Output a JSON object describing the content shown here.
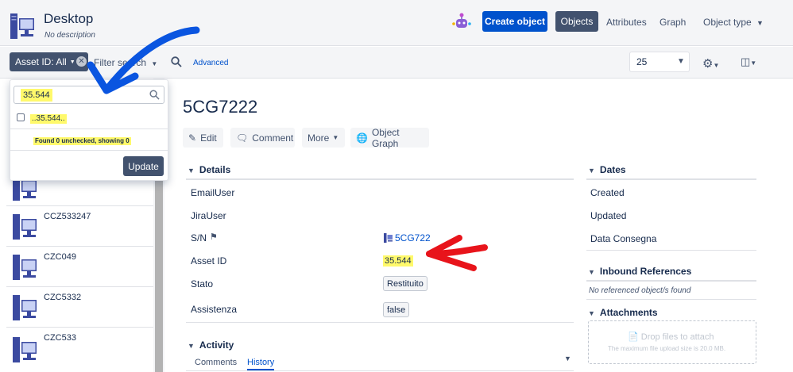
{
  "header": {
    "title": "Desktop",
    "subtitle": "No description",
    "create_label": "Create object",
    "objects_label": "Objects",
    "attributes_label": "Attributes",
    "graph_label": "Graph",
    "object_type_label": "Object type"
  },
  "toolbar": {
    "filter_chip_label": "Asset ID: All",
    "filter_search_label": "Filter search",
    "advanced_label": "Advanced",
    "per_page_value": "25"
  },
  "popup": {
    "search_value": "35.544",
    "option_label": "..35.544..",
    "found_text": "Found 0 unchecked, showing 0",
    "update_label": "Update"
  },
  "list": {
    "items": [
      {
        "label": ""
      },
      {
        "label": "CCZ533247"
      },
      {
        "label": "CZC049"
      },
      {
        "label": "CZC5332"
      },
      {
        "label": "CZC533"
      }
    ]
  },
  "object": {
    "title": "5CG7222",
    "actions": {
      "edit": "Edit",
      "comment": "Comment",
      "more": "More",
      "graph": "Object Graph"
    }
  },
  "details": {
    "heading": "Details",
    "fields": [
      {
        "label": "EmailUser",
        "value": ""
      },
      {
        "label": "JiraUser",
        "value": ""
      },
      {
        "label": "S/N",
        "value": "5CG722"
      },
      {
        "label": "Asset ID",
        "value": "35.544"
      },
      {
        "label": "Stato",
        "value": "Restituito"
      },
      {
        "label": "Assistenza",
        "value": "false"
      }
    ]
  },
  "dates": {
    "heading": "Dates",
    "items": [
      "Created",
      "Updated",
      "Data Consegna"
    ]
  },
  "inbound": {
    "heading": "Inbound References",
    "empty_text": "No referenced object/s found"
  },
  "attachments": {
    "heading": "Attachments",
    "drop_title": "Drop files to attach",
    "drop_sub": "The maximum file upload size is 20.0 MB."
  },
  "activity": {
    "heading": "Activity",
    "tabs": [
      "Comments",
      "History"
    ]
  },
  "icons": {
    "app": "desktop-computer-icon",
    "robot": "automation-robot-icon",
    "search": "search-icon",
    "settings": "gear-icon",
    "view": "view-layout-icon",
    "tag": "tag-icon"
  },
  "colors": {
    "primary": "#0052cc",
    "dark_button": "#42526e",
    "highlight": "#fff96b",
    "annotation_blue": "#0a55e0",
    "annotation_red": "#e8141b"
  }
}
